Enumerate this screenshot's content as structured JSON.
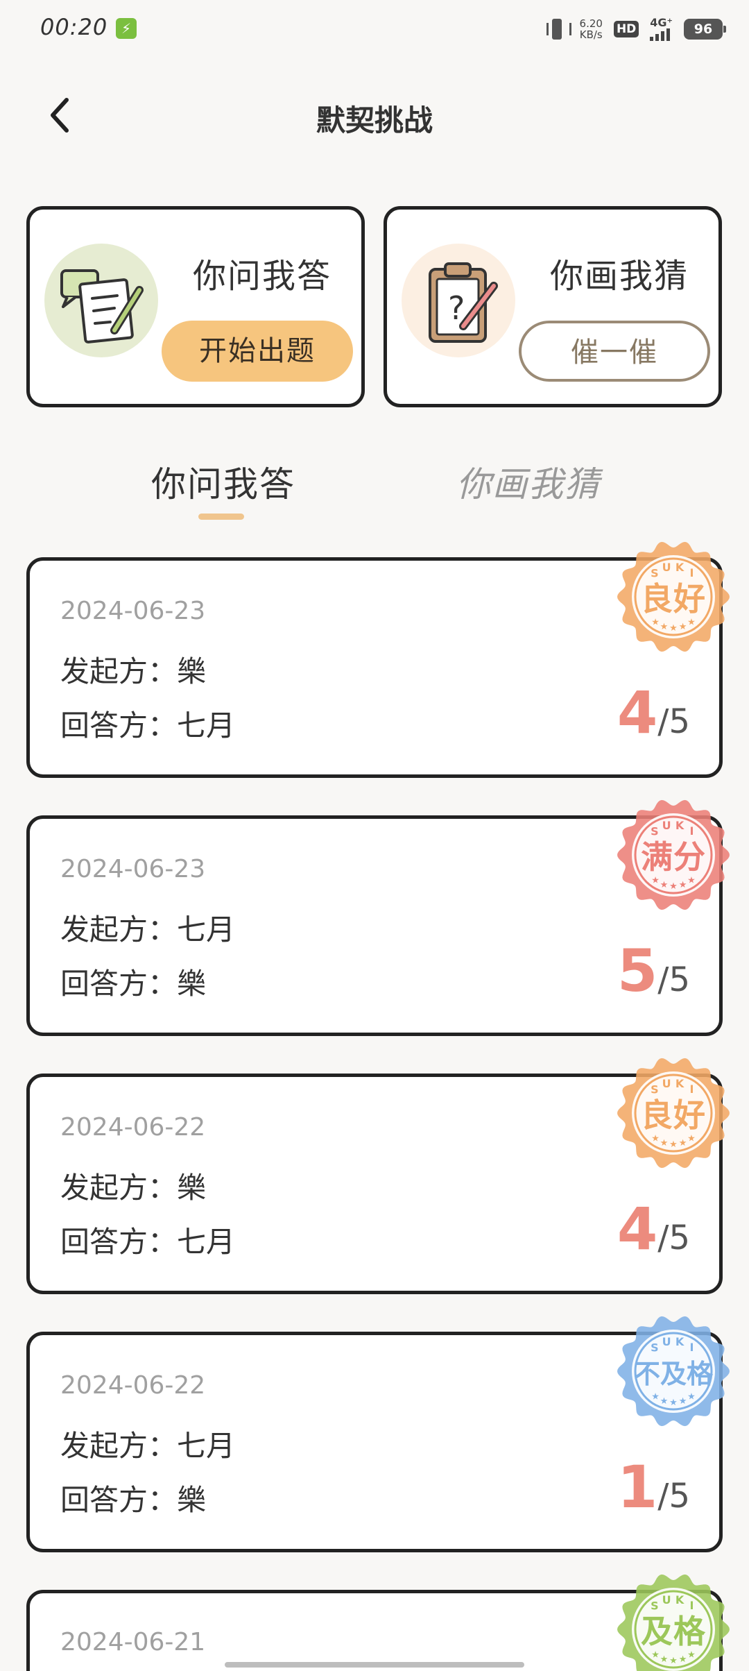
{
  "status_bar": {
    "time": "00:20",
    "net_speed_value": "6.20",
    "net_speed_unit": "KB/s",
    "hd": "HD",
    "network": "4G⁺",
    "battery": "96"
  },
  "header": {
    "title": "默契挑战"
  },
  "mode_cards": [
    {
      "title": "你问我答",
      "button": "开始出题"
    },
    {
      "title": "你画我猜",
      "button": "催一催"
    }
  ],
  "tabs": [
    {
      "label": "你问我答"
    },
    {
      "label": "你画我猜"
    }
  ],
  "labels": {
    "initiator": "发起方：",
    "responder": "回答方："
  },
  "records": [
    {
      "date": "2024-06-23",
      "initiator": "樂",
      "responder": "七月",
      "score": "4",
      "total": "/5",
      "stamp": "良好",
      "stamp_color": "#f2a865"
    },
    {
      "date": "2024-06-23",
      "initiator": "七月",
      "responder": "樂",
      "score": "5",
      "total": "/5",
      "stamp": "满分",
      "stamp_color": "#ec8078"
    },
    {
      "date": "2024-06-22",
      "initiator": "樂",
      "responder": "七月",
      "score": "4",
      "total": "/5",
      "stamp": "良好",
      "stamp_color": "#f2a865"
    },
    {
      "date": "2024-06-22",
      "initiator": "七月",
      "responder": "樂",
      "score": "1",
      "total": "/5",
      "stamp": "不及格",
      "stamp_color": "#7fb1e6"
    },
    {
      "date": "2024-06-21",
      "stamp": "及格",
      "stamp_color": "#9cc75a"
    }
  ],
  "stamp_brand": "SUKI"
}
